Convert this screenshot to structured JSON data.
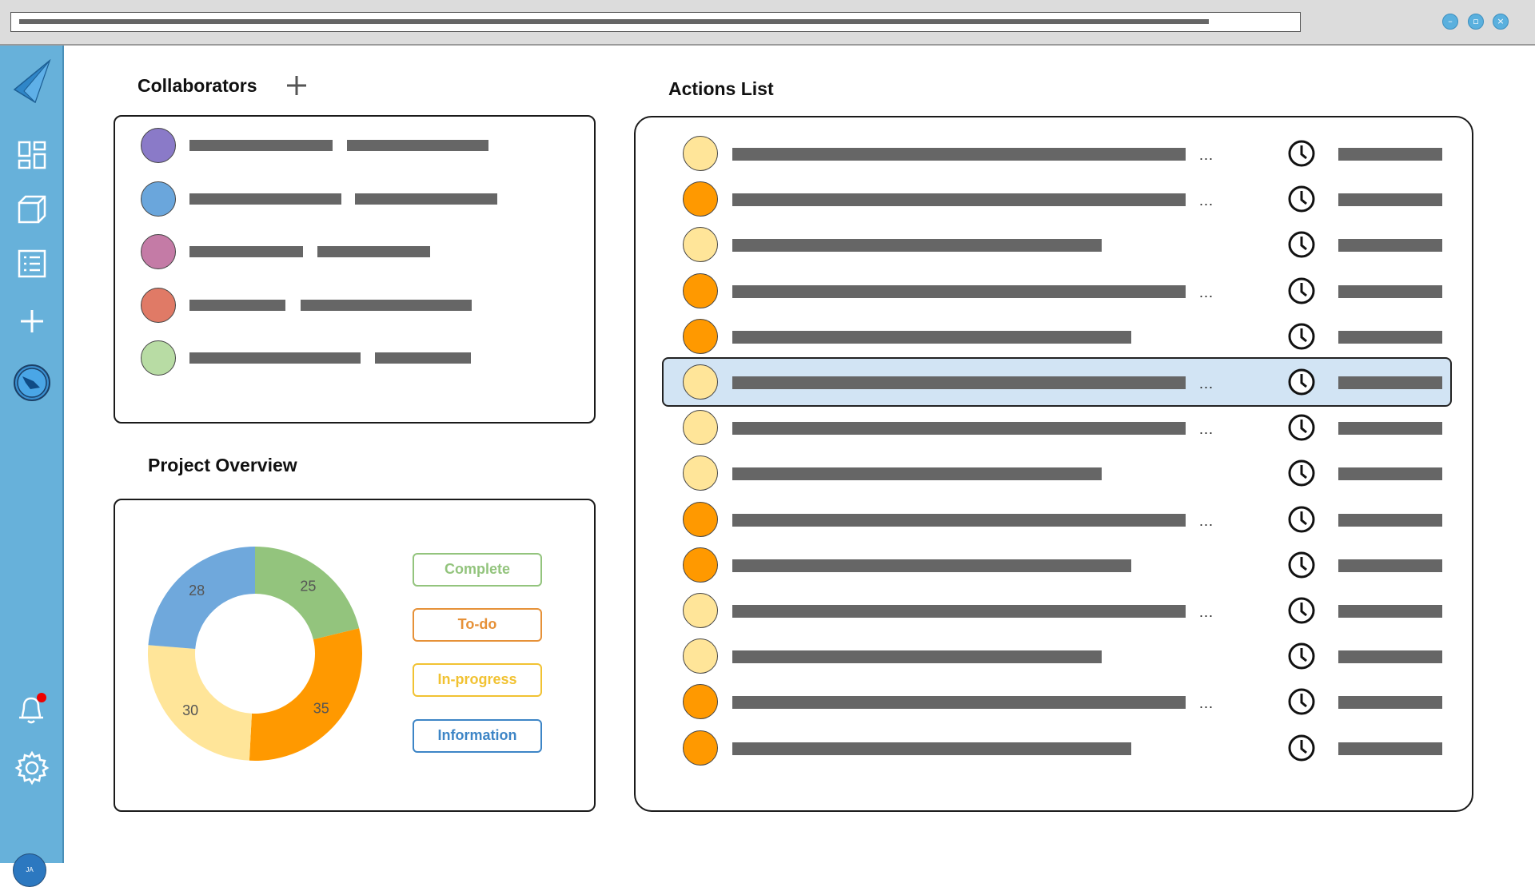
{
  "window": {
    "controls": [
      "minimize",
      "maximize",
      "close"
    ],
    "accent": "#5ab0de"
  },
  "sidebar": {
    "color": "#67b1da",
    "items": [
      {
        "icon": "app-logo-icon"
      },
      {
        "icon": "dashboard-grid-icon"
      },
      {
        "icon": "cube-icon"
      },
      {
        "icon": "list-icon"
      },
      {
        "icon": "plus-icon"
      },
      {
        "icon": "globe-icon"
      },
      {
        "icon": "bell-icon",
        "has_notification": true
      },
      {
        "icon": "gear-icon"
      }
    ],
    "user_initials": "JA"
  },
  "collaborators": {
    "title": "Collaborators",
    "add_icon": "plus-icon",
    "members": [
      {
        "color": "#8a7ac8"
      },
      {
        "color": "#6aa6dc"
      },
      {
        "color": "#c47ba6"
      },
      {
        "color": "#e07a66"
      },
      {
        "color": "#b8dca4"
      }
    ]
  },
  "overview": {
    "title": "Project Overview",
    "legend": [
      {
        "label": "Complete",
        "color": "#93c47d"
      },
      {
        "label": "To-do",
        "color": "#e69138"
      },
      {
        "label": "In-progress",
        "color": "#f1c232"
      },
      {
        "label": "Information",
        "color": "#3d85c6"
      }
    ]
  },
  "chart_data": {
    "type": "pie",
    "donut": true,
    "slices": [
      {
        "value": 25,
        "color": "#93c47d"
      },
      {
        "value": 35,
        "color": "#ff9900"
      },
      {
        "value": 30,
        "color": "#ffe599"
      },
      {
        "value": 28,
        "color": "#6fa8dc"
      }
    ]
  },
  "actions": {
    "title": "Actions List",
    "selected_index": 5,
    "items": [
      {
        "status_color": "#ffe599",
        "has_more": true
      },
      {
        "status_color": "#ff9900",
        "has_more": true
      },
      {
        "status_color": "#ffe599",
        "has_more": false
      },
      {
        "status_color": "#ff9900",
        "has_more": true
      },
      {
        "status_color": "#ff9900",
        "has_more": false
      },
      {
        "status_color": "#ffe599",
        "has_more": true
      },
      {
        "status_color": "#ffe599",
        "has_more": true
      },
      {
        "status_color": "#ffe599",
        "has_more": false
      },
      {
        "status_color": "#ff9900",
        "has_more": true
      },
      {
        "status_color": "#ff9900",
        "has_more": false
      },
      {
        "status_color": "#ffe599",
        "has_more": true
      },
      {
        "status_color": "#ffe599",
        "has_more": false
      },
      {
        "status_color": "#ff9900",
        "has_more": true
      },
      {
        "status_color": "#ff9900",
        "has_more": false
      }
    ],
    "more_label": "...",
    "time_icon": "clock-icon"
  }
}
